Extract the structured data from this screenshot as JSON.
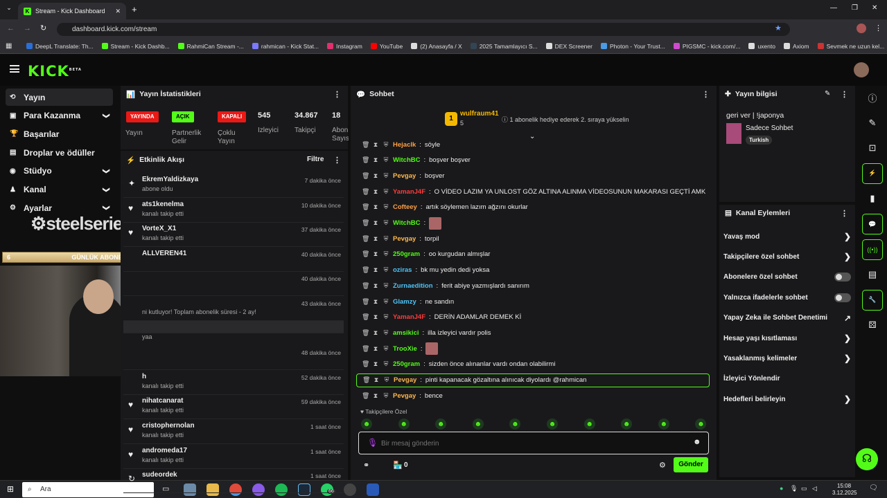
{
  "browser": {
    "tab_title": "Stream - Kick Dashboard",
    "url": "dashboard.kick.com/stream",
    "bookmarks": [
      "DeepL Translate: Th...",
      "Stream - Kick Dashb...",
      "RahmiCan Stream -...",
      "rahmican - Kick Stat...",
      "Instagram",
      "YouTube",
      "(2) Anasayfa / X",
      "2025 Tamamlayıcı S...",
      "DEX Screener",
      "Photon - Your Trust...",
      "PIGSMC - kick.com/...",
      "uxento",
      "Axiom",
      "Sevmek ne uzun kel..."
    ]
  },
  "kick": {
    "logo": "KICK",
    "beta": "BETA"
  },
  "sidebar": {
    "items": [
      {
        "label": "Yayın",
        "icon": "broadcast-icon",
        "chev": ""
      },
      {
        "label": "Para Kazanma",
        "icon": "money-icon",
        "chev": "❯"
      },
      {
        "label": "Başarılar",
        "icon": "trophy-icon",
        "chev": ""
      },
      {
        "label": "Droplar ve ödüller",
        "icon": "gift-icon",
        "chev": ""
      },
      {
        "label": "Stüdyo",
        "icon": "studio-icon",
        "chev": "❯"
      },
      {
        "label": "Kanal",
        "icon": "channel-icon",
        "chev": "❯"
      },
      {
        "label": "Ayarlar",
        "icon": "gear-icon",
        "chev": "❯"
      }
    ]
  },
  "overlay": {
    "brand": "steelseries",
    "bar_left": "6",
    "bar_title": "GÜNLÜK ABONE",
    "bar_right": "5"
  },
  "stats": {
    "title": "Yayın İstatistikleri",
    "badges": [
      {
        "text": "YAYINDA",
        "label": "Yayın"
      },
      {
        "text": "AÇIK",
        "label": "Partnerlik Gelir"
      },
      {
        "text": "KAPALI",
        "label": "Çoklu Yayın"
      }
    ],
    "numbers": [
      {
        "value": "545",
        "label": "İzleyici"
      },
      {
        "value": "34.867",
        "label": "Takipçi"
      },
      {
        "value": "18",
        "label": "Abon Sayıs"
      }
    ]
  },
  "activity": {
    "title": "Etkinlik Akışı",
    "filter": "Filtre",
    "items": [
      {
        "name": "EkremYaldizkaya",
        "sub": "abone oldu",
        "time": "7 dakika önce",
        "icon": "✦"
      },
      {
        "name": "ats1kenelma",
        "sub": "kanalı takip etti",
        "time": "10 dakika önce",
        "icon": "♥"
      },
      {
        "name": "VorteX_X1",
        "sub": "kanalı takip etti",
        "time": "37 dakika önce",
        "icon": "♥"
      },
      {
        "name": "ALLVEREN41",
        "sub": "",
        "time": "40 dakika önce",
        "icon": ""
      },
      {
        "name": "",
        "sub": "",
        "time": "40 dakika önce",
        "icon": ""
      },
      {
        "name": "",
        "sub": "ni kutluyor! Toplam abonelik süresi - 2 ay!",
        "time": "43 dakika önce",
        "icon": ""
      },
      {
        "name": "",
        "sub": "yaa",
        "time": "",
        "icon": ""
      },
      {
        "name": "",
        "sub": "",
        "time": "48 dakika önce",
        "icon": ""
      },
      {
        "name": "h",
        "sub": "kanalı takip etti",
        "time": "52 dakika önce",
        "icon": ""
      },
      {
        "name": "nihatcanarat",
        "sub": "kanalı takip etti",
        "time": "59 dakika önce",
        "icon": "♥"
      },
      {
        "name": "cristophernolan",
        "sub": "kanalı takip etti",
        "time": "1 saat önce",
        "icon": "♥"
      },
      {
        "name": "andromeda17",
        "sub": "kanalı takip etti",
        "time": "1 saat önce",
        "icon": "♥"
      },
      {
        "name": "sudeordek",
        "sub": "",
        "time": "1 saat önce",
        "icon": "↻"
      }
    ]
  },
  "chat": {
    "title": "Sohbet",
    "top_user": "wulfraum41",
    "top_count": "5",
    "top_rank": "1",
    "promo": "1 abonelik hediye ederek 2. sıraya yükselin",
    "messages": [
      {
        "user": "Hejaclk",
        "color": "#ff9f43",
        "text": "söyle"
      },
      {
        "user": "WitchBC",
        "color": "#53fc18",
        "text": "boşver boşver"
      },
      {
        "user": "Pevgay",
        "color": "#ffb74d",
        "text": "boşver"
      },
      {
        "user": "YamanJ4F",
        "color": "#ff3b3b",
        "text": "O VİDEO LAZIM YA UNLOST GÖZ ALTINA ALINMA VİDEOSUNUN MAKARASI GEÇTİ AMK"
      },
      {
        "user": "Cofteey",
        "color": "#ff9f43",
        "text": "artık söylemen lazım ağzını okurlar"
      },
      {
        "user": "WitchBC",
        "color": "#53fc18",
        "text": ""
      },
      {
        "user": "Pevgay",
        "color": "#ffb74d",
        "text": "torpil"
      },
      {
        "user": "250gram",
        "color": "#53fc18",
        "text": "oo kurgudan almışlar"
      },
      {
        "user": "oziras",
        "color": "#4fc3f7",
        "text": "bk mu yedin dedi yoksa"
      },
      {
        "user": "Zurnaedition",
        "color": "#4fc3f7",
        "text": "ferit abiye yazmışlardı sanırım"
      },
      {
        "user": "Glamzy",
        "color": "#4fc3f7",
        "text": "ne sandın"
      },
      {
        "user": "YamanJ4F",
        "color": "#ff3b3b",
        "text": "DERİN ADAMLAR DEMEK Kİ"
      },
      {
        "user": "amsikici",
        "color": "#53fc18",
        "text": "illa izleyici vardır polis"
      },
      {
        "user": "TrooXie",
        "color": "#53fc18",
        "text": ""
      },
      {
        "user": "250gram",
        "color": "#53fc18",
        "text": "sizden önce alınanlar vardı ondan olabilirmi"
      },
      {
        "user": "Pevgay",
        "color": "#ffb74d",
        "text": "pinti kapanacak gözaltına alınıcak diyolardı @rahmican"
      },
      {
        "user": "Pevgay",
        "color": "#ffb74d",
        "text": "bence"
      }
    ],
    "followers_only": "Takipçilere Özel",
    "placeholder": "Bir mesaj gönderin",
    "send": "Gönder",
    "count": "0"
  },
  "info": {
    "title": "Yayın bilgisi",
    "stream_title": "geri ver | !japonya",
    "category": "Sadece Sohbet",
    "tag": "Turkish"
  },
  "actions": {
    "title": "Kanal Eylemleri",
    "items": [
      {
        "label": "Yavaş mod",
        "kind": "arrow"
      },
      {
        "label": "Takipçilere özel sohbet",
        "kind": "arrow"
      },
      {
        "label": "Abonelere özel sohbet",
        "kind": "toggle"
      },
      {
        "label": "Yalnızca ifadelerle sohbet",
        "kind": "toggle"
      },
      {
        "label": "Yapay Zeka ile Sohbet Denetimi",
        "kind": "ext"
      },
      {
        "label": "Hesap yaşı kısıtlaması",
        "kind": "arrow"
      },
      {
        "label": "Yasaklanmış kelimeler",
        "kind": "arrow"
      },
      {
        "label": "İzleyici Yönlendir",
        "kind": "none"
      },
      {
        "label": "Hedefleri belirleyin",
        "kind": "arrow"
      }
    ]
  },
  "taskbar": {
    "search": "Ara",
    "time": "15:08",
    "date": "3.12.2025",
    "badge": "66"
  },
  "colors": {
    "accent": "#53fc18",
    "live": "#e91916"
  }
}
